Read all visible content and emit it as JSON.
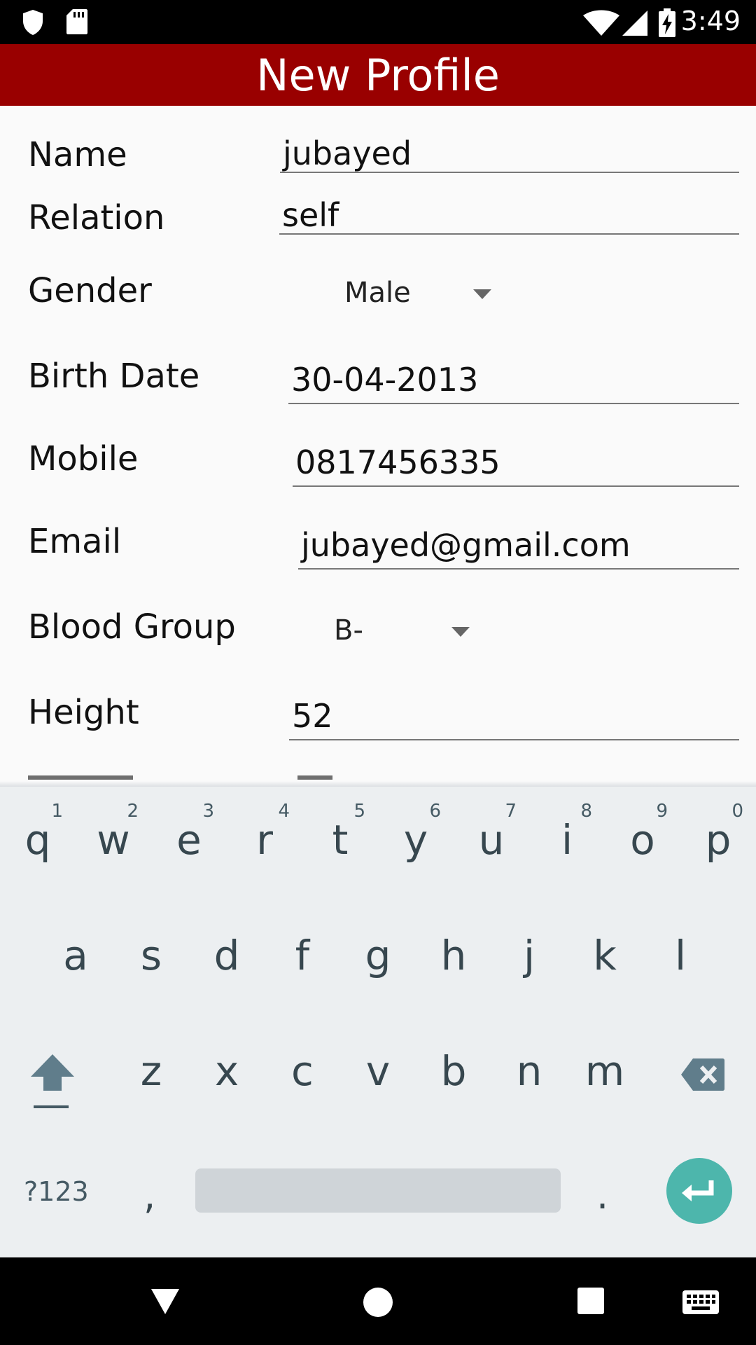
{
  "status_bar": {
    "time": "3:49",
    "icons": [
      "shield-icon",
      "sd-card-icon",
      "wifi-icon",
      "cell-signal-icon",
      "battery-charging-icon"
    ]
  },
  "app_bar": {
    "title": "New Profile"
  },
  "form": {
    "name": {
      "label": "Name",
      "value": "jubayed"
    },
    "relation": {
      "label": "Relation",
      "value": "self"
    },
    "gender": {
      "label": "Gender",
      "value": "Male"
    },
    "birth_date": {
      "label": "Birth Date",
      "value": "30-04-2013"
    },
    "mobile": {
      "label": "Mobile",
      "value": "0817456335"
    },
    "email": {
      "label": "Email",
      "value": "jubayed@gmail.com"
    },
    "blood_group": {
      "label": "Blood Group",
      "value": "B-"
    },
    "height": {
      "label": "Height",
      "value": "52"
    }
  },
  "keyboard": {
    "row1": [
      {
        "key": "q",
        "hint": "1"
      },
      {
        "key": "w",
        "hint": "2"
      },
      {
        "key": "e",
        "hint": "3"
      },
      {
        "key": "r",
        "hint": "4"
      },
      {
        "key": "t",
        "hint": "5"
      },
      {
        "key": "y",
        "hint": "6"
      },
      {
        "key": "u",
        "hint": "7"
      },
      {
        "key": "i",
        "hint": "8"
      },
      {
        "key": "o",
        "hint": "9"
      },
      {
        "key": "p",
        "hint": "0"
      }
    ],
    "row2": [
      "a",
      "s",
      "d",
      "f",
      "g",
      "h",
      "j",
      "k",
      "l"
    ],
    "row3": [
      "z",
      "x",
      "c",
      "v",
      "b",
      "n",
      "m"
    ],
    "symbols_label": "?123",
    "comma": ",",
    "period": "."
  },
  "nav_bar": {
    "icons": [
      "back-icon",
      "home-icon",
      "recents-icon",
      "keyboard-switch-icon"
    ]
  }
}
